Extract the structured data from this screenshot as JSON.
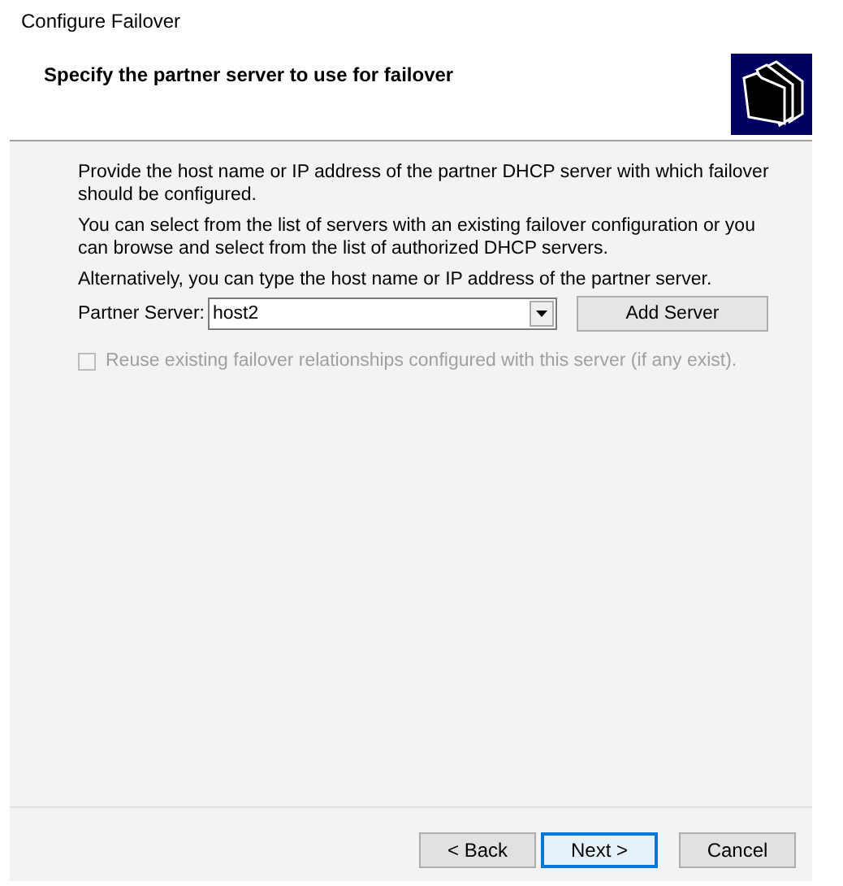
{
  "window": {
    "title": "Configure Failover"
  },
  "header": {
    "heading": "Specify the partner server to use for failover"
  },
  "paragraphs": [
    "Provide the host name or IP address of the partner DHCP server with which failover should be configured.",
    "You can select from the list of servers with an existing failover configuration or you can browse and select from the list of authorized DHCP servers.",
    "Alternatively, you can type the host name or IP address of the partner server."
  ],
  "partner_server": {
    "label": "Partner Server:",
    "value": "host2",
    "button": "Add Server"
  },
  "reuse_checkbox": {
    "label": "Reuse existing failover relationships configured with this server (if any exist).",
    "checked": false,
    "disabled": true
  },
  "buttons": [
    {
      "label": "< Back",
      "default": false
    },
    {
      "label": "Next >",
      "default": true
    },
    {
      "label": "Cancel",
      "default": false
    }
  ]
}
